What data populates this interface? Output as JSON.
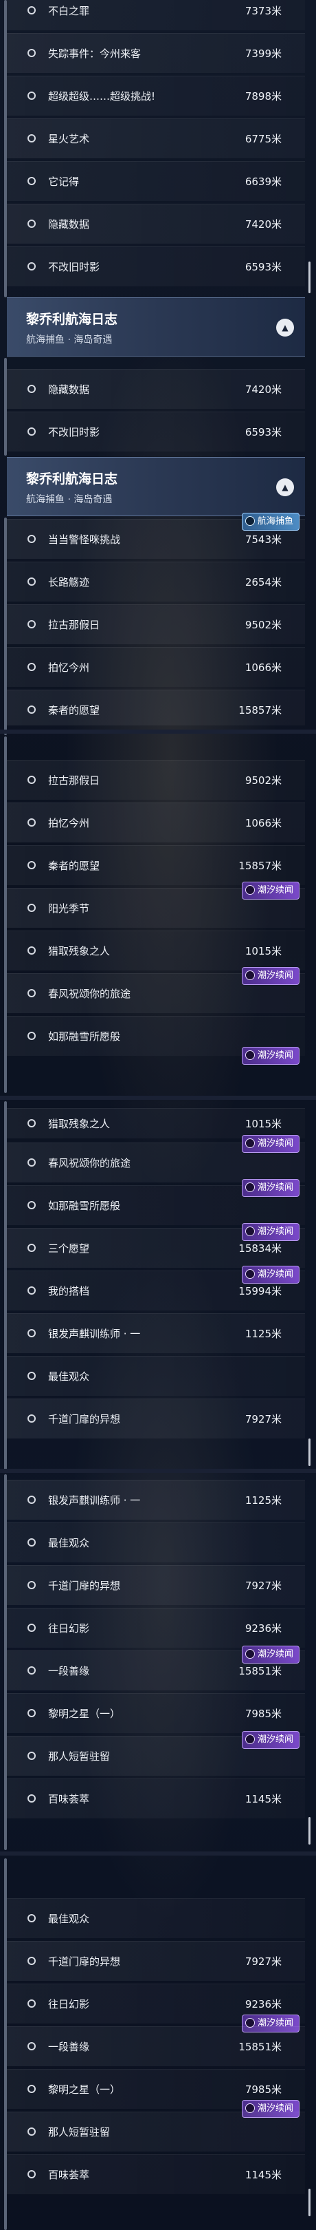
{
  "tags": {
    "purple": "潮汐续闻",
    "blue": "航海捕鱼"
  },
  "header": {
    "title": "黎乔利航海日志",
    "subtitle": "航海捕鱼 · 海岛奇遇"
  },
  "sections": [
    {
      "items": [
        {
          "label": "不白之罪",
          "distance": "7373米"
        },
        {
          "label": "失踪事件：今州来客",
          "distance": "7399米"
        },
        {
          "label": "超级超级……超级挑战!",
          "distance": "7898米"
        },
        {
          "label": "星火艺术",
          "distance": "6775米"
        },
        {
          "label": "它记得",
          "distance": "6639米"
        },
        {
          "label": "隐藏数据",
          "distance": "7420米"
        },
        {
          "label": "不改旧时影",
          "distance": "6593米"
        }
      ]
    },
    {
      "items": [
        {
          "label": "隐藏数据",
          "distance": "7420米"
        },
        {
          "label": "不改旧时影",
          "distance": "6593米"
        }
      ]
    },
    {
      "items": [
        {
          "label": "当当警怪咪挑战",
          "distance": "7543米"
        },
        {
          "label": "长路觞迹",
          "distance": "2654米"
        },
        {
          "label": "拉古那假日",
          "distance": "9502米"
        },
        {
          "label": "拍忆今州",
          "distance": "1066米"
        },
        {
          "label": "秦者的愿望",
          "distance": "15857米"
        }
      ]
    },
    {
      "items": [
        {
          "label": "拉古那假日",
          "distance": "9502米"
        },
        {
          "label": "拍忆今州",
          "distance": "1066米"
        },
        {
          "label": "秦者的愿望",
          "distance": "15857米"
        },
        {
          "label": "阳光季节",
          "distance": ""
        },
        {
          "label": "猎取残象之人",
          "distance": "1015米"
        },
        {
          "label": "春风祝颂你的旅途",
          "distance": ""
        },
        {
          "label": "如那融雪所愿般",
          "distance": ""
        }
      ]
    },
    {
      "items": [
        {
          "label": "猎取残象之人",
          "distance": "1015米"
        },
        {
          "label": "春风祝颂你的旅途",
          "distance": ""
        },
        {
          "label": "如那融雪所愿般",
          "distance": ""
        },
        {
          "label": "三个愿望",
          "distance": "15834米"
        },
        {
          "label": "我的搭档",
          "distance": "15994米"
        },
        {
          "label": "银发声麒训练师 · 一",
          "distance": "1125米"
        },
        {
          "label": "最佳观众",
          "distance": ""
        },
        {
          "label": "千道门扉的异想",
          "distance": "7927米"
        }
      ]
    },
    {
      "items": [
        {
          "label": "银发声麒训练师 · 一",
          "distance": "1125米"
        },
        {
          "label": "最佳观众",
          "distance": ""
        },
        {
          "label": "千道门扉的异想",
          "distance": "7927米"
        },
        {
          "label": "往日幻影",
          "distance": "9236米"
        },
        {
          "label": "一段善缘",
          "distance": "15851米"
        },
        {
          "label": "黎明之星（一）",
          "distance": "7985米"
        },
        {
          "label": "那人短暂驻留",
          "distance": ""
        },
        {
          "label": "百味荟萃",
          "distance": "1145米"
        }
      ]
    },
    {
      "items": [
        {
          "label": "最佳观众",
          "distance": ""
        },
        {
          "label": "千道门扉的异想",
          "distance": "7927米"
        },
        {
          "label": "往日幻影",
          "distance": "9236米"
        },
        {
          "label": "一段善缘",
          "distance": "15851米"
        },
        {
          "label": "黎明之星（一）",
          "distance": "7985米"
        },
        {
          "label": "那人短暂驻留",
          "distance": ""
        },
        {
          "label": "百味荟萃",
          "distance": "1145米"
        }
      ]
    }
  ]
}
